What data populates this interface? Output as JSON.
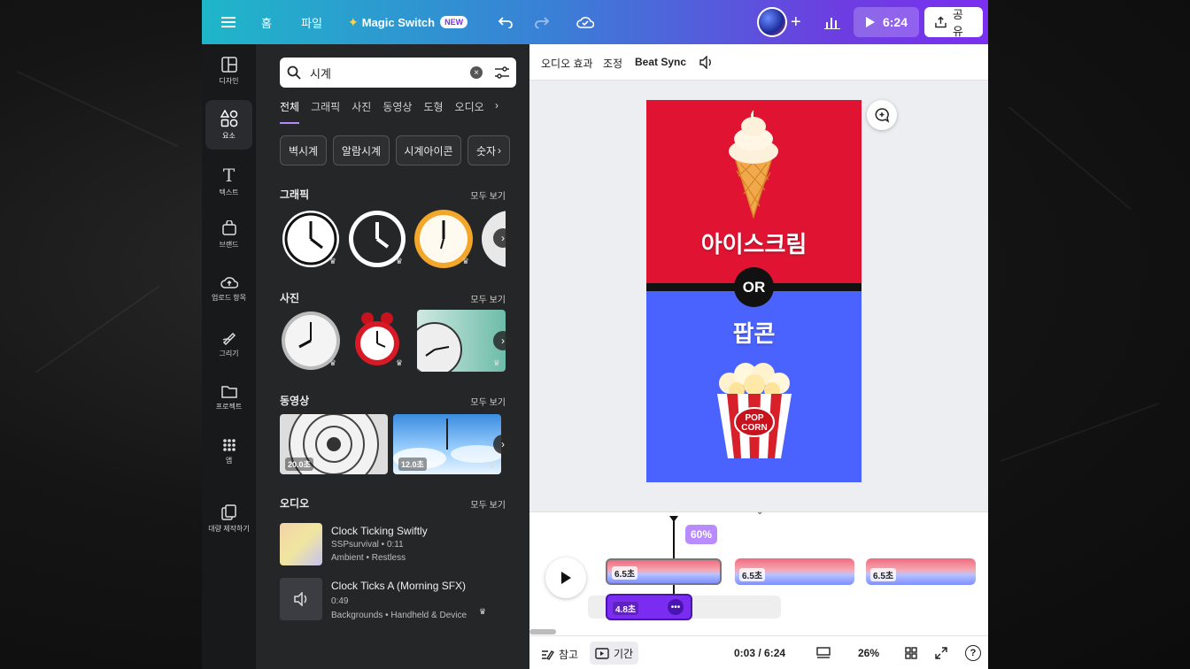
{
  "topbar": {
    "menu_icon": "hamburger-icon",
    "home": "홈",
    "file": "파일",
    "magic_switch": "Magic Switch",
    "new_badge": "NEW",
    "play_time": "6:24",
    "share": "공유"
  },
  "rail": {
    "items": [
      {
        "label": "디자인",
        "icon": "layout-icon"
      },
      {
        "label": "요소",
        "icon": "shapes-icon"
      },
      {
        "label": "텍스트",
        "icon": "text-icon"
      },
      {
        "label": "브랜드",
        "icon": "brand-icon"
      },
      {
        "label": "업로드 항목",
        "icon": "upload-icon"
      },
      {
        "label": "그리기",
        "icon": "draw-icon"
      },
      {
        "label": "프로젝트",
        "icon": "folder-icon"
      },
      {
        "label": "앱",
        "icon": "apps-icon"
      },
      {
        "label": "대량 제작하기",
        "icon": "bulk-create-icon"
      }
    ]
  },
  "panel": {
    "search_value": "시계",
    "tabs": [
      "전체",
      "그래픽",
      "사진",
      "동영상",
      "도형",
      "오디오"
    ],
    "chips": [
      "벽시계",
      "알람시계",
      "시계아이콘",
      "숫자"
    ],
    "sections": {
      "graphics": "그래픽",
      "photos": "사진",
      "videos": "동영상",
      "audio": "오디오",
      "see_all": "모두 보기"
    },
    "video_durations": [
      "20.0초",
      "12.0초"
    ],
    "audio_items": [
      {
        "title": "Clock Ticking Swiftly",
        "meta": "SSPsurvival • 0:11",
        "tags": "Ambient • Restless"
      },
      {
        "title": "Clock Ticks A (Morning SFX)",
        "meta": "0:49",
        "tags": "Backgrounds • Handheld & Device"
      }
    ]
  },
  "editor": {
    "toolbar": [
      "오디오 효과",
      "조정",
      "Beat Sync"
    ],
    "canvas": {
      "top_text": "아이스크림",
      "or_text": "OR",
      "bottom_text": "팝콘",
      "popcorn_label_1": "POP",
      "popcorn_label_2": "CORN"
    },
    "colors": {
      "top": "#e01432",
      "bottom": "#4a63ff"
    }
  },
  "timeline": {
    "volume_badge": "60%",
    "clips": [
      "6.5초",
      "6.5초",
      "6.5초"
    ],
    "audio_clip": "4.8초"
  },
  "bottombar": {
    "notes": "참고",
    "duration": "기간",
    "time": "0:03 / 6:24",
    "zoom": "26%"
  }
}
